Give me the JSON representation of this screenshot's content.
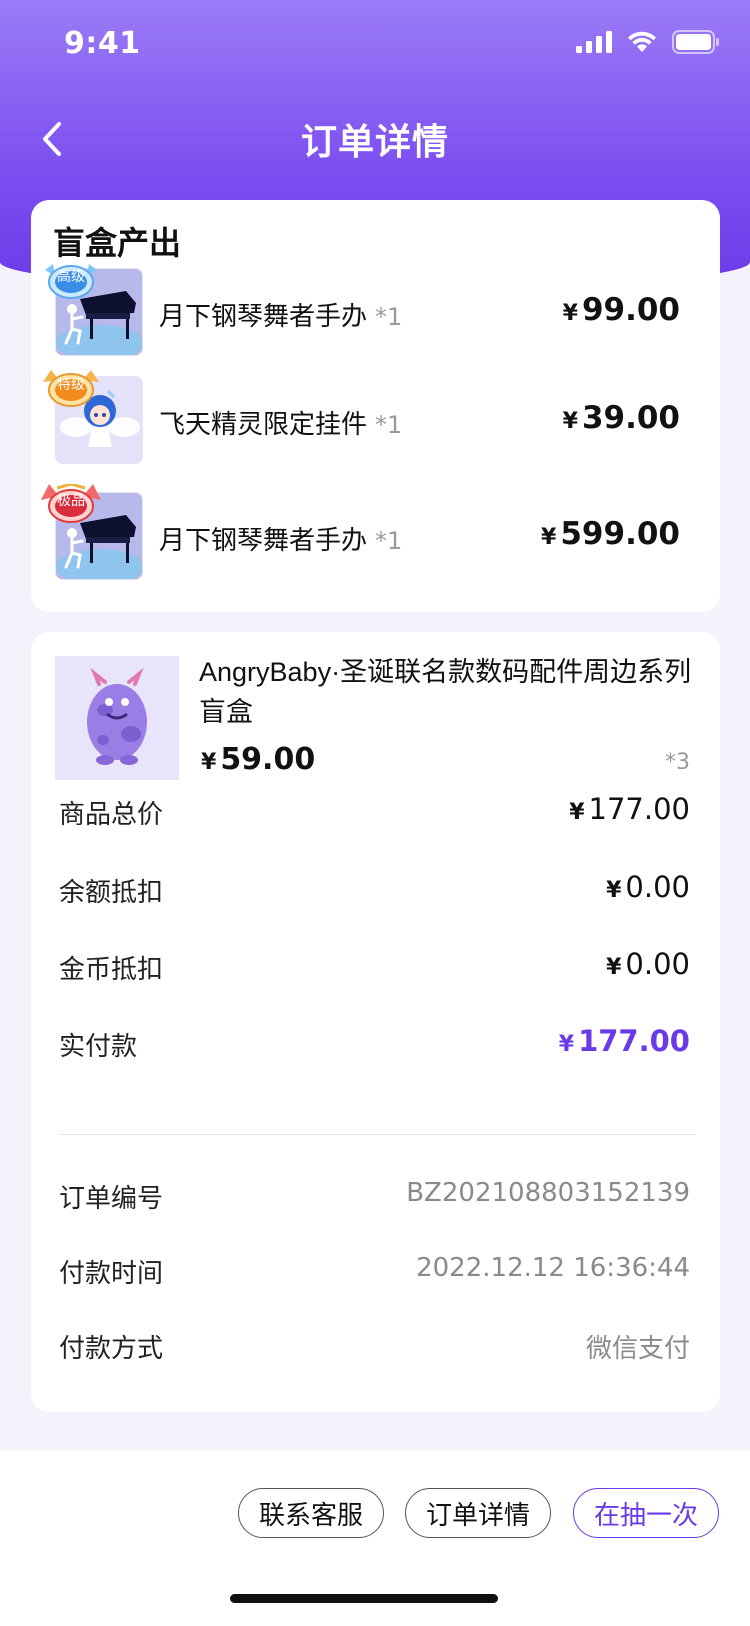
{
  "status_bar": {
    "time": "9:41"
  },
  "nav": {
    "title": "订单详情"
  },
  "output": {
    "title": "盲盒产出",
    "items": [
      {
        "tier": "高级",
        "name": "月下钢琴舞者手办",
        "qty": "*1",
        "currency": "¥",
        "price": "99.00",
        "art": "piano"
      },
      {
        "tier": "特级",
        "name": "飞天精灵限定挂件",
        "qty": "*1",
        "currency": "¥",
        "price": "39.00",
        "art": "fairy"
      },
      {
        "tier": "极品",
        "name": "月下钢琴舞者手办",
        "qty": "*1",
        "currency": "¥",
        "price": "599.00",
        "art": "piano"
      }
    ]
  },
  "product": {
    "title": "AngryBaby·圣诞联名款数码配件周边系列盲盒",
    "currency": "¥",
    "price": "59.00",
    "qty": "*3"
  },
  "summary": {
    "total_label": "商品总价",
    "total_currency": "¥",
    "total_value": "177.00",
    "balance_label": "余额抵扣",
    "balance_currency": "¥",
    "balance_value": "0.00",
    "coin_label": "金币抵扣",
    "coin_currency": "¥",
    "coin_value": "0.00",
    "paid_label": "实付款",
    "paid_currency": "¥",
    "paid_value": "177.00"
  },
  "order_info": {
    "number_label": "订单编号",
    "number_value": "BZ202108803152139",
    "time_label": "付款时间",
    "time_value": "2022.12.12 16:36:44",
    "method_label": "付款方式",
    "method_value": "微信支付"
  },
  "actions": {
    "contact": "联系客服",
    "details": "订单详情",
    "again": "在抽一次"
  },
  "colors": {
    "accent": "#6b3ae8",
    "header_top": "#9b7cf6",
    "header_bottom": "#6b3ae8"
  }
}
